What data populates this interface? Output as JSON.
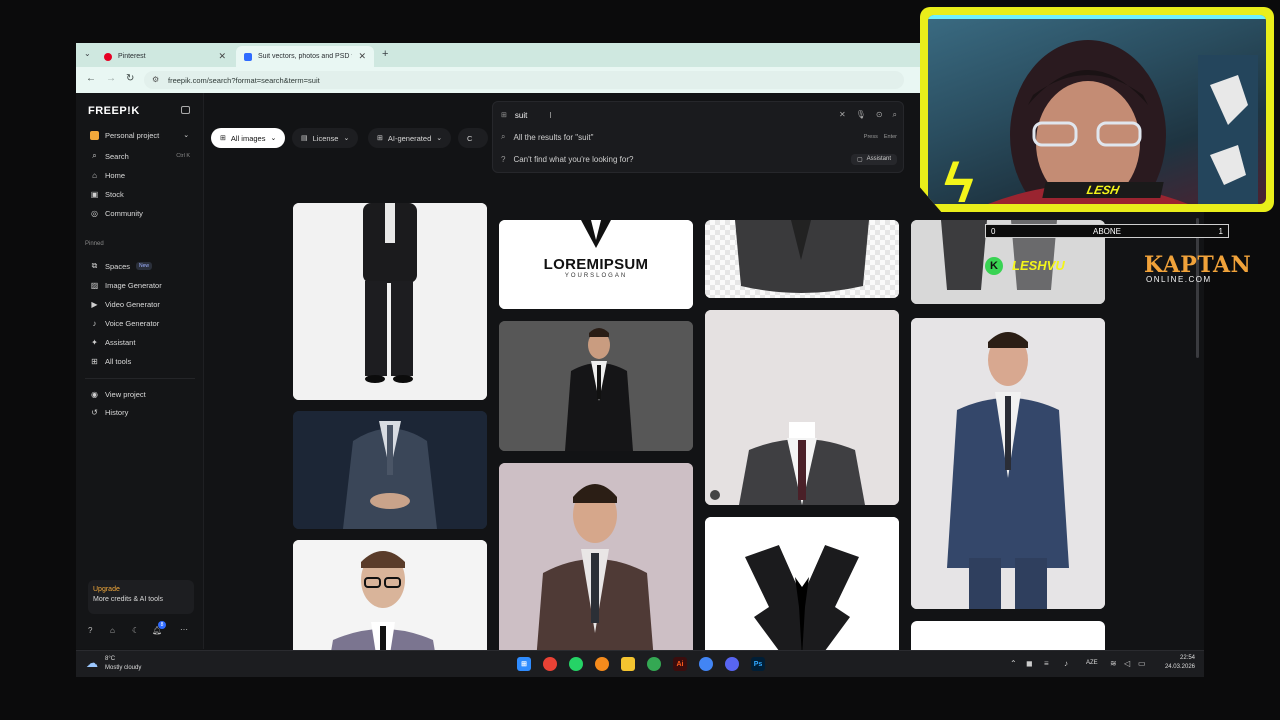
{
  "browser": {
    "tabs": [
      {
        "label": "Pinterest",
        "active": false
      },
      {
        "label": "Suit vectors, photos and PSD fi",
        "active": true
      }
    ],
    "new_tab": "+",
    "url": "freepik.com/search?format=search&term=suit"
  },
  "sidebar": {
    "logo": "FREEP!K",
    "project": "Personal project",
    "items": [
      {
        "label": "Search",
        "icon": "search-icon",
        "shortcut": "Ctrl K"
      },
      {
        "label": "Home",
        "icon": "home-icon"
      },
      {
        "label": "Stock",
        "icon": "stock-icon"
      },
      {
        "label": "Community",
        "icon": "globe-icon"
      }
    ],
    "pinned_title": "Pinned",
    "pinned": [
      {
        "label": "Spaces",
        "icon": "spaces-icon",
        "badge": "New"
      },
      {
        "label": "Image Generator",
        "icon": "image-icon"
      },
      {
        "label": "Video Generator",
        "icon": "video-icon"
      },
      {
        "label": "Voice Generator",
        "icon": "voice-icon"
      },
      {
        "label": "Assistant",
        "icon": "assistant-icon"
      },
      {
        "label": "All tools",
        "icon": "grid-icon"
      }
    ],
    "bottom": [
      {
        "label": "View project",
        "icon": "eye-icon"
      },
      {
        "label": "History",
        "icon": "history-icon"
      }
    ],
    "upgrade_title": "Upgrade",
    "upgrade_sub": "More credits & AI tools",
    "notif_count": "8"
  },
  "filters": {
    "all_images": "All images",
    "license": "License",
    "ai_generated": "AI-generated",
    "extra": "C"
  },
  "search": {
    "query": "suit",
    "all_results": "All the results for \"suit\"",
    "press": "Press",
    "enter": "Enter",
    "cant_find": "Can't find what you're looking for?",
    "assistant": "Assistant"
  },
  "results": {
    "logo_card_title": "LOREMIPSUM",
    "logo_card_sub": "YOURSLOGAN"
  },
  "taskbar": {
    "weather_temp": "8°C",
    "weather_desc": "Mostly cloudy",
    "lang": "AZE",
    "time": "22:54",
    "date": "24.03.2026"
  },
  "overlay": {
    "streamer_name": "LESH",
    "abone_left": "0",
    "abone_label": "ABONE",
    "abone_right": "1",
    "handle": "LESHVU",
    "brand_top": "KAPTAN",
    "brand_bottom": "ONLINE.COM"
  },
  "colors": {
    "overlay_yellow": "#e9ee1a",
    "page_bg": "#121315",
    "tab_bar": "#cfe8e0",
    "upgrade_accent": "#f2a93b",
    "kaptan_orange": "#f0a23a"
  }
}
